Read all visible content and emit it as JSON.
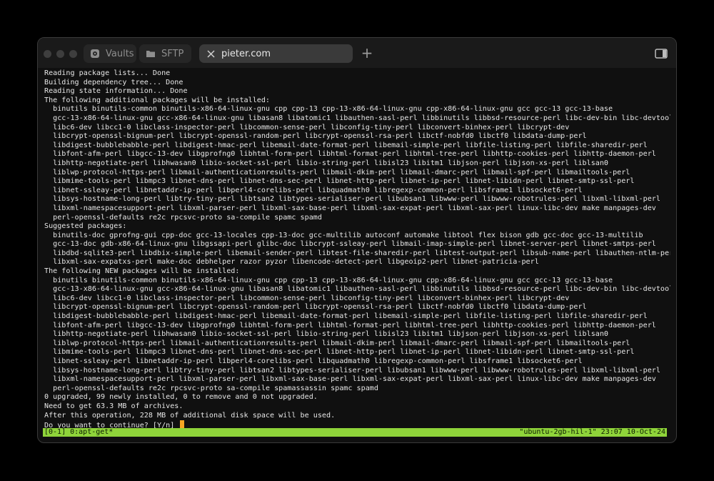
{
  "window": {
    "tabs": [
      {
        "label": "Vaults",
        "icon": "vault-icon",
        "active": false
      },
      {
        "label": "SFTP",
        "icon": "folder-icon",
        "active": false
      },
      {
        "label": "pieter.com",
        "icon": "close-icon",
        "active": true
      }
    ],
    "new_tab_label": "+"
  },
  "terminal": {
    "lines": [
      "Reading package lists... Done",
      "Building dependency tree... Done",
      "Reading state information... Done",
      "The following additional packages will be installed:",
      "  binutils binutils-common binutils-x86-64-linux-gnu cpp cpp-13 cpp-13-x86-64-linux-gnu cpp-x86-64-linux-gnu gcc gcc-13 gcc-13-base",
      "  gcc-13-x86-64-linux-gnu gcc-x86-64-linux-gnu libasan8 libatomic1 libauthen-sasl-perl libbinutils libbsd-resource-perl libc-dev-bin libc-devtools",
      "  libc6-dev libcc1-0 libclass-inspector-perl libcommon-sense-perl libconfig-tiny-perl libconvert-binhex-perl libcrypt-dev",
      "  libcrypt-openssl-bignum-perl libcrypt-openssl-random-perl libcrypt-openssl-rsa-perl libctf-nobfd0 libctf0 libdata-dump-perl",
      "  libdigest-bubblebabble-perl libdigest-hmac-perl libemail-date-format-perl libemail-simple-perl libfile-listing-perl libfile-sharedir-perl",
      "  libfont-afm-perl libgcc-13-dev libgprofng0 libhtml-form-perl libhtml-format-perl libhtml-tree-perl libhttp-cookies-perl libhttp-daemon-perl",
      "  libhttp-negotiate-perl libhwasan0 libio-socket-ssl-perl libio-string-perl libisl23 libitm1 libjson-perl libjson-xs-perl liblsan0",
      "  liblwp-protocol-https-perl libmail-authenticationresults-perl libmail-dkim-perl libmail-dmarc-perl libmail-spf-perl libmailtools-perl",
      "  libmime-tools-perl libmpc3 libnet-dns-perl libnet-dns-sec-perl libnet-http-perl libnet-ip-perl libnet-libidn-perl libnet-smtp-ssl-perl",
      "  libnet-ssleay-perl libnetaddr-ip-perl libperl4-corelibs-perl libquadmath0 libregexp-common-perl libsframe1 libsocket6-perl",
      "  libsys-hostname-long-perl libtry-tiny-perl libtsan2 libtypes-serialiser-perl libubsan1 libwww-perl libwww-robotrules-perl libxml-libxml-perl",
      "  libxml-namespacesupport-perl libxml-parser-perl libxml-sax-base-perl libxml-sax-expat-perl libxml-sax-perl linux-libc-dev make manpages-dev",
      "  perl-openssl-defaults re2c rpcsvc-proto sa-compile spamc spamd",
      "Suggested packages:",
      "  binutils-doc gprofng-gui cpp-doc gcc-13-locales cpp-13-doc gcc-multilib autoconf automake libtool flex bison gdb gcc-doc gcc-13-multilib",
      "  gcc-13-doc gdb-x86-64-linux-gnu libgssapi-perl glibc-doc libcrypt-ssleay-perl libmail-imap-simple-perl libnet-server-perl libnet-smtps-perl",
      "  libdbd-sqlite3-perl libdbix-simple-perl libemail-sender-perl libtest-file-sharedir-perl libtest-output-perl libsub-name-perl libauthen-ntlm-perl",
      "  libxml-sax-expatxs-perl make-doc debhelper razor pyzor libencode-detect-perl libgeoip2-perl libnet-patricia-perl",
      "The following NEW packages will be installed:",
      "  binutils binutils-common binutils-x86-64-linux-gnu cpp cpp-13 cpp-13-x86-64-linux-gnu cpp-x86-64-linux-gnu gcc gcc-13 gcc-13-base",
      "  gcc-13-x86-64-linux-gnu gcc-x86-64-linux-gnu libasan8 libatomic1 libauthen-sasl-perl libbinutils libbsd-resource-perl libc-dev-bin libc-devtools",
      "  libc6-dev libcc1-0 libclass-inspector-perl libcommon-sense-perl libconfig-tiny-perl libconvert-binhex-perl libcrypt-dev",
      "  libcrypt-openssl-bignum-perl libcrypt-openssl-random-perl libcrypt-openssl-rsa-perl libctf-nobfd0 libctf0 libdata-dump-perl",
      "  libdigest-bubblebabble-perl libdigest-hmac-perl libemail-date-format-perl libemail-simple-perl libfile-listing-perl libfile-sharedir-perl",
      "  libfont-afm-perl libgcc-13-dev libgprofng0 libhtml-form-perl libhtml-format-perl libhtml-tree-perl libhttp-cookies-perl libhttp-daemon-perl",
      "  libhttp-negotiate-perl libhwasan0 libio-socket-ssl-perl libio-string-perl libisl23 libitm1 libjson-perl libjson-xs-perl liblsan0",
      "  liblwp-protocol-https-perl libmail-authenticationresults-perl libmail-dkim-perl libmail-dmarc-perl libmail-spf-perl libmailtools-perl",
      "  libmime-tools-perl libmpc3 libnet-dns-perl libnet-dns-sec-perl libnet-http-perl libnet-ip-perl libnet-libidn-perl libnet-smtp-ssl-perl",
      "  libnet-ssleay-perl libnetaddr-ip-perl libperl4-corelibs-perl libquadmath0 libregexp-common-perl libsframe1 libsocket6-perl",
      "  libsys-hostname-long-perl libtry-tiny-perl libtsan2 libtypes-serialiser-perl libubsan1 libwww-perl libwww-robotrules-perl libxml-libxml-perl",
      "  libxml-namespacesupport-perl libxml-parser-perl libxml-sax-base-perl libxml-sax-expat-perl libxml-sax-perl linux-libc-dev make manpages-dev",
      "  perl-openssl-defaults re2c rpcsvc-proto sa-compile spamassassin spamc spamd",
      "0 upgraded, 99 newly installed, 0 to remove and 0 not upgraded.",
      "Need to get 63.3 MB of archives.",
      "After this operation, 228 MB of additional disk space will be used."
    ],
    "prompt": "Do you want to continue? [Y/n] ",
    "cursor_color": "#f5a623"
  },
  "statusbar": {
    "left": "[0-1] 0:apt-get*",
    "right": "\"ubuntu-2gb-hil-1\" 23:07 10-Oct-24",
    "color": "#8fd43a"
  }
}
